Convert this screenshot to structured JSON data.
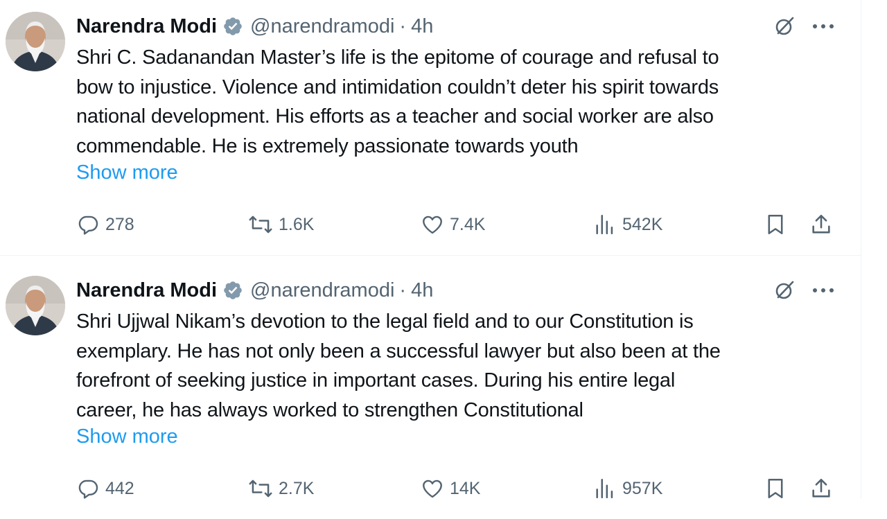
{
  "tweets": [
    {
      "author_name": "Narendra Modi",
      "handle": "@narendramodi",
      "separator": "·",
      "time": "4h",
      "lines": [
        "Shri C. Sadanandan Master’s life is the epitome of courage and refusal to",
        "bow to injustice. Violence and intimidation couldn’t deter his spirit towards",
        "national development. His efforts as a teacher and social worker are also",
        "commendable. He is extremely passionate towards youth"
      ],
      "show_more": "Show more",
      "replies": "278",
      "reposts": "1.6K",
      "likes": "7.4K",
      "views": "542K"
    },
    {
      "author_name": "Narendra Modi",
      "handle": "@narendramodi",
      "separator": "·",
      "time": "4h",
      "lines": [
        "Shri Ujjwal Nikam’s devotion to the legal field and to our Constitution is",
        "exemplary. He has not only been a successful lawyer but also been at the",
        "forefront of seeking justice in important cases. During his entire legal",
        "career, he has always worked to strengthen Constitutional"
      ],
      "show_more": "Show more",
      "replies": "442",
      "reposts": "2.7K",
      "likes": "14K",
      "views": "957K"
    }
  ],
  "icons": {
    "verified": "verified-badge-icon",
    "grok": "grok-icon",
    "more": "more-options-icon",
    "reply": "reply-icon",
    "repost": "repost-icon",
    "like": "heart-icon",
    "views": "views-icon",
    "bookmark": "bookmark-icon",
    "share": "share-icon"
  },
  "colors": {
    "link": "#1d9bf0",
    "secondary": "#536471",
    "verified": "#829aab",
    "text": "#0f1419"
  }
}
